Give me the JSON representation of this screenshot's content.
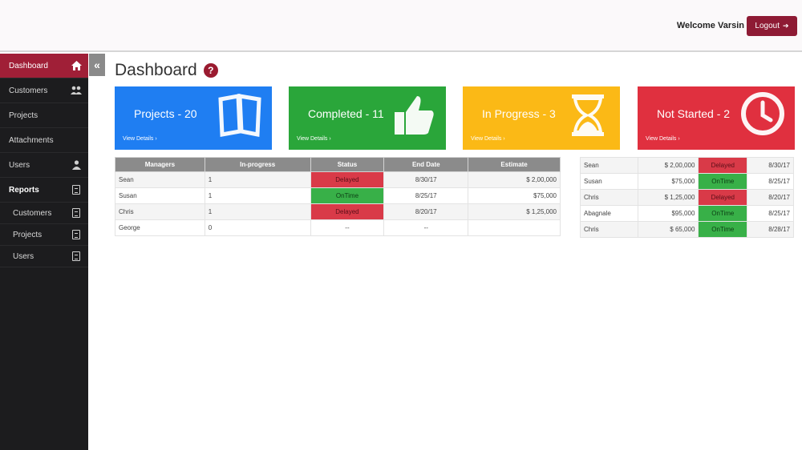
{
  "header": {
    "welcome": "Welcome Varsin",
    "logout_label": "Logout"
  },
  "sidebar": {
    "items": [
      {
        "label": "Dashboard"
      },
      {
        "label": "Customers"
      },
      {
        "label": "Projects"
      },
      {
        "label": "Attachments"
      },
      {
        "label": "Users"
      }
    ],
    "reports_label": "Reports",
    "report_items": [
      {
        "label": "Customers"
      },
      {
        "label": "Projects"
      },
      {
        "label": "Users"
      }
    ],
    "collapse_glyph": "«"
  },
  "page": {
    "title": "Dashboard",
    "help_glyph": "?"
  },
  "cards": [
    {
      "title": "Projects - 20",
      "details": "View Details ›",
      "color": "#1f7ef2",
      "icon": "book-icon"
    },
    {
      "title": "Completed - 11",
      "details": "View Details ›",
      "color": "#2aa63a",
      "icon": "thumbs-up-icon"
    },
    {
      "title": "In Progress - 3",
      "details": "View Details ›",
      "color": "#fbb916",
      "icon": "hourglass-icon"
    },
    {
      "title": "Not Started - 2",
      "details": "View Details ›",
      "color": "#e0303f",
      "icon": "clock-icon"
    }
  ],
  "managers_table": {
    "headers": [
      "Managers",
      "In-progress",
      "Status",
      "End Date",
      "Estimate"
    ],
    "rows": [
      {
        "manager": "Sean",
        "in_progress": "1",
        "status": "Delayed",
        "end_date": "8/30/17",
        "estimate": "$ 2,00,000"
      },
      {
        "manager": "Susan",
        "in_progress": "1",
        "status": "OnTime",
        "end_date": "8/25/17",
        "estimate": "$75,000"
      },
      {
        "manager": "Chris",
        "in_progress": "1",
        "status": "Delayed",
        "end_date": "8/20/17",
        "estimate": "$ 1,25,000"
      },
      {
        "manager": "George",
        "in_progress": "0",
        "status": "--",
        "end_date": "--",
        "estimate": ""
      }
    ]
  },
  "employees_table": {
    "rows": [
      {
        "name": "Sean",
        "amount": "$ 2,00,000",
        "status": "Delayed",
        "date": "8/30/17"
      },
      {
        "name": "Susan",
        "amount": "$75,000",
        "status": "OnTime",
        "date": "8/25/17"
      },
      {
        "name": "Chris",
        "amount": "$ 1,25,000",
        "status": "Delayed",
        "date": "8/20/17"
      },
      {
        "name": "Abagnale",
        "amount": "$95,000",
        "status": "OnTime",
        "date": "8/25/17"
      },
      {
        "name": "Chris",
        "amount": "$ 65,000",
        "status": "OnTime",
        "date": "8/28/17"
      }
    ]
  },
  "colors": {
    "accent": "#a01f37",
    "delayed": "#d93a48",
    "ontime": "#38b048"
  }
}
